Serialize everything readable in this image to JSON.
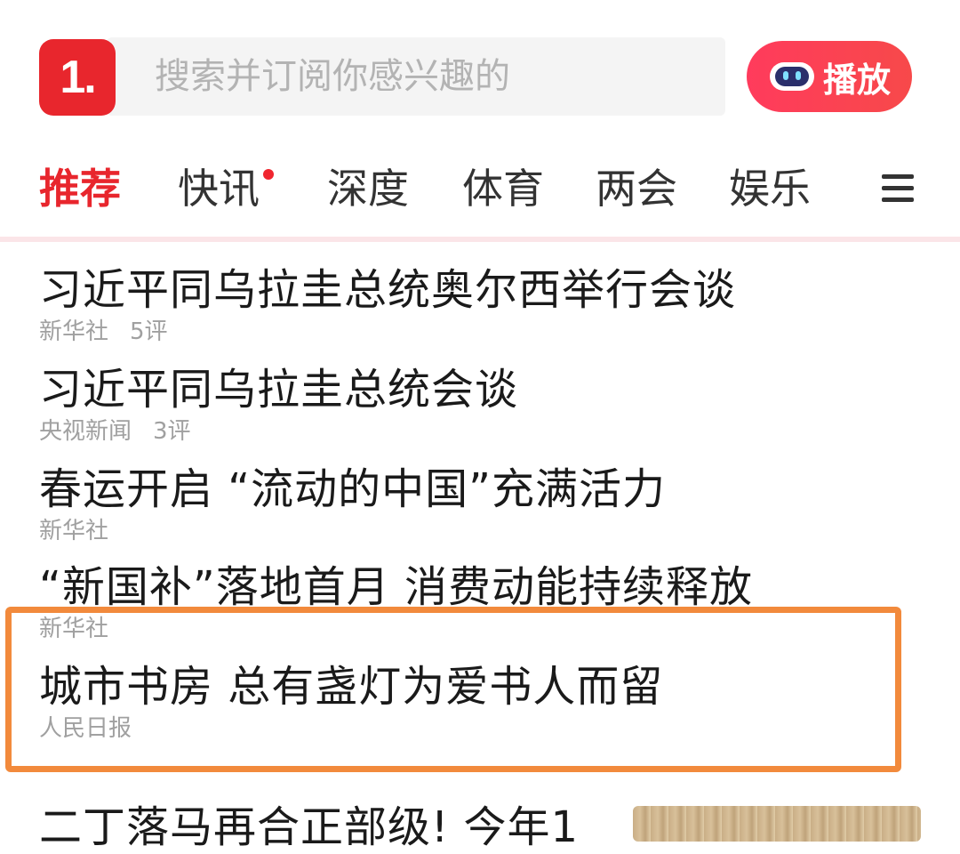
{
  "header": {
    "logo_text": "1.",
    "search_placeholder": "搜索并订阅你感兴趣的",
    "play_label": "播放"
  },
  "tabs": [
    {
      "label": "推荐",
      "active": true
    },
    {
      "label": "快讯",
      "badge": true
    },
    {
      "label": "深度"
    },
    {
      "label": "体育"
    },
    {
      "label": "两会"
    },
    {
      "label": "娱乐"
    }
  ],
  "news": [
    {
      "title": "习近平同乌拉圭总统奥尔西举行会谈",
      "source": "新华社",
      "comments": "5评"
    },
    {
      "title": "习近平同乌拉圭总统会谈",
      "source": "央视新闻",
      "comments": "3评"
    },
    {
      "title": "春运开启 “流动的中国”充满活力",
      "source": "新华社"
    },
    {
      "title": "“新国补”落地首月 消费动能持续释放",
      "source": "新华社"
    },
    {
      "title": "城市书房 总有盏灯为爱书人而留",
      "source": "人民日报"
    },
    {
      "title": "二丁落马再合正部级! 今年1"
    }
  ],
  "colors": {
    "accent": "#e8262d",
    "highlight": "#f28a3c",
    "meta": "#a0a0a0"
  }
}
